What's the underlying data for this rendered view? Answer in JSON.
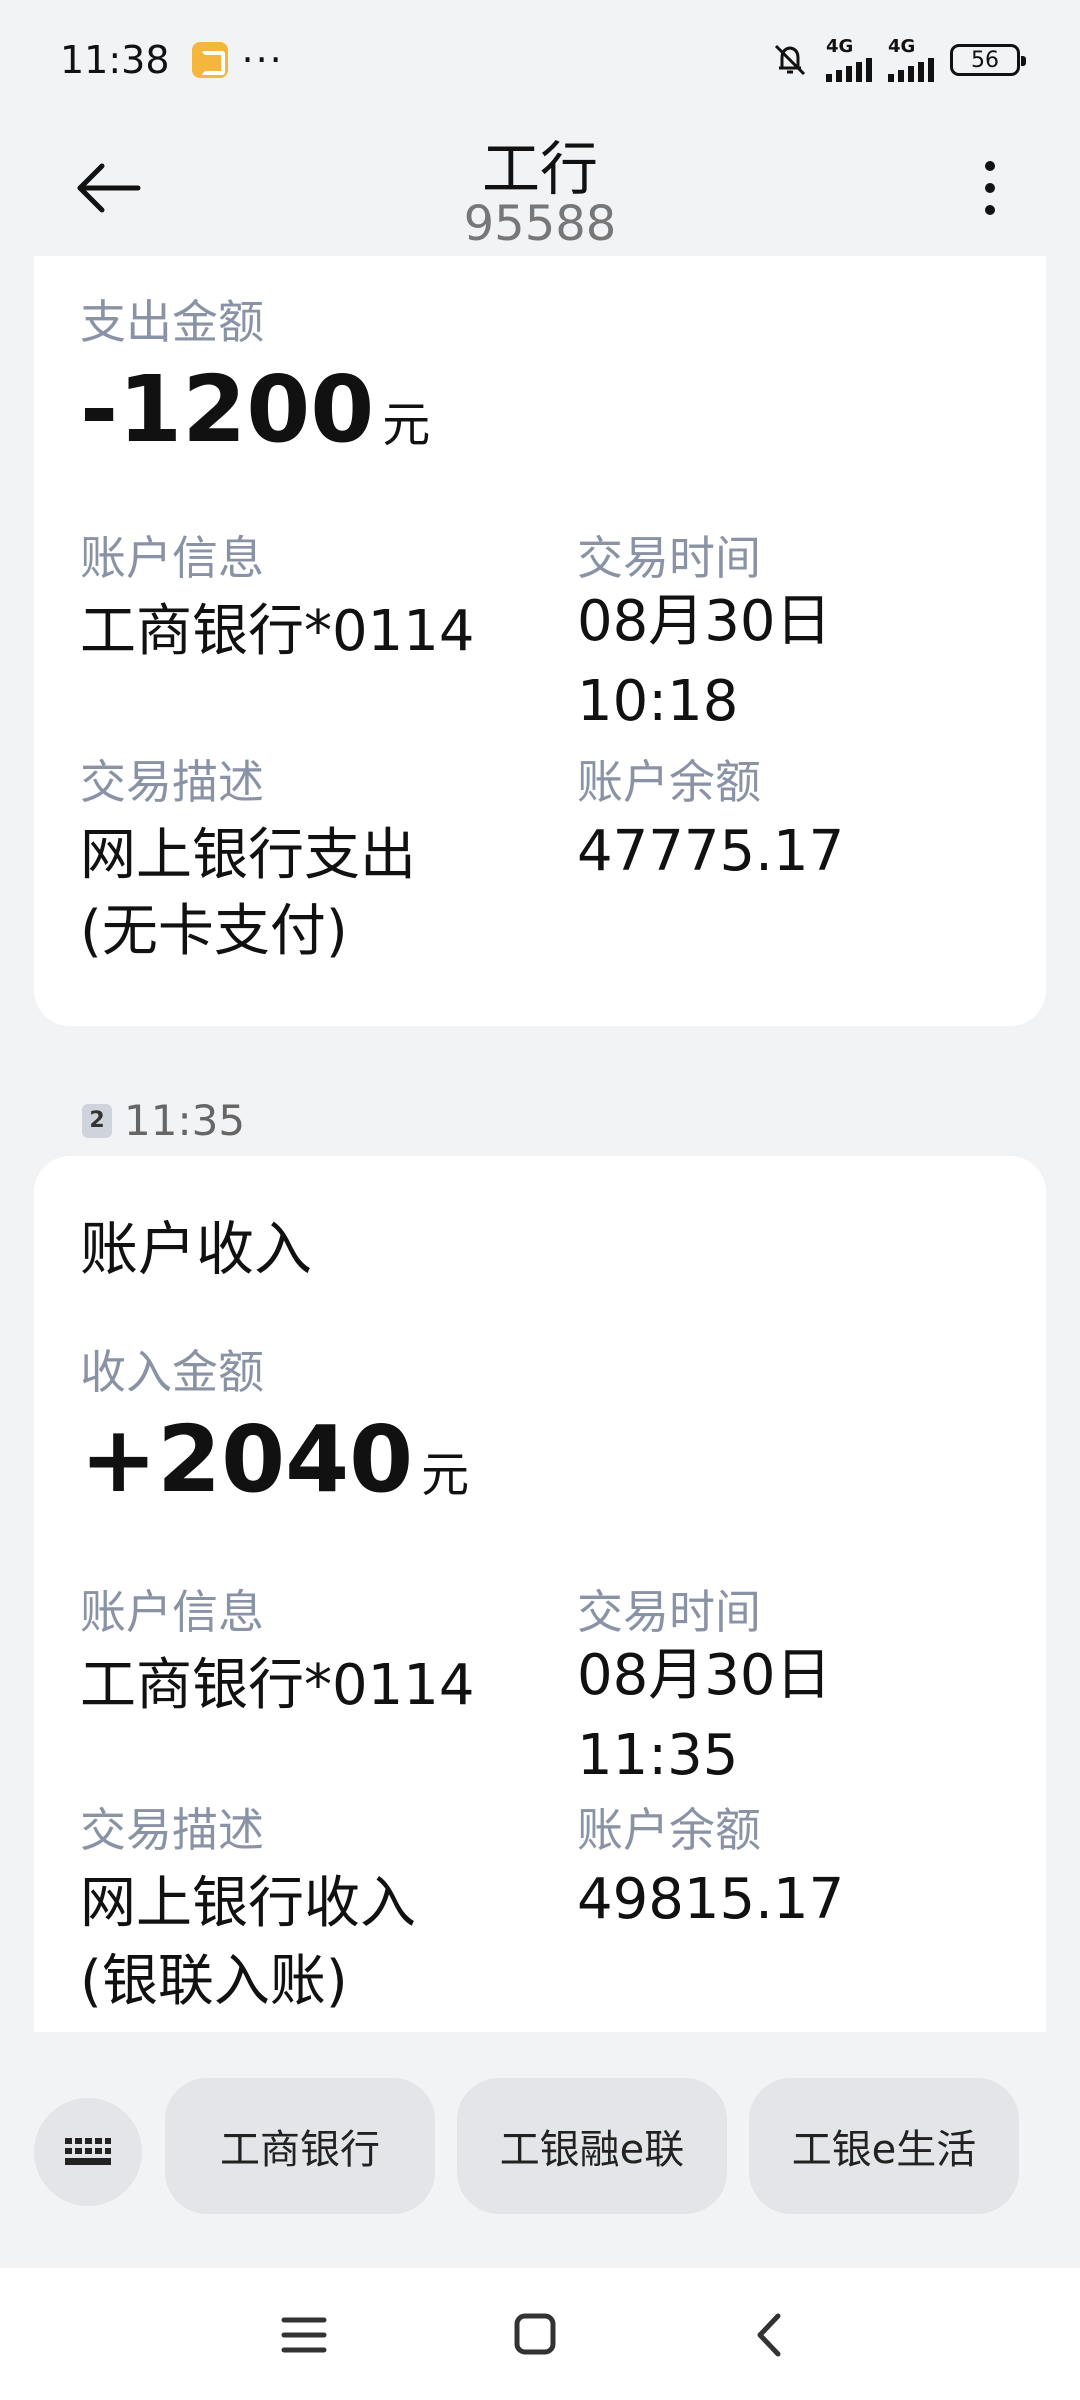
{
  "status_bar": {
    "time": "11:38",
    "dots": "···",
    "signal1_label": "4G",
    "signal2_label": "4G",
    "battery": "56"
  },
  "header": {
    "title": "工行",
    "subtitle": "95588"
  },
  "messages": [
    {
      "amount_label": "支出金额",
      "amount": "-1200",
      "unit": "元",
      "account_label": "账户信息",
      "account": "工商银行*0114",
      "time_label": "交易时间",
      "time_date": "08月30日",
      "time_clock": "10:18",
      "desc_label": "交易描述",
      "desc_line1": "网上银行支出",
      "desc_line2": "(无卡支付)",
      "balance_label": "账户余额",
      "balance": "47775.17"
    },
    {
      "timestamp": "11:35",
      "sim": "2",
      "title": "账户收入",
      "amount_label": "收入金额",
      "amount": "+2040",
      "unit": "元",
      "account_label": "账户信息",
      "account": "工商银行*0114",
      "time_label": "交易时间",
      "time_date": "08月30日",
      "time_clock": "11:35",
      "desc_label": "交易描述",
      "desc_line1": "网上银行收入",
      "desc_line2": "(银联入账)",
      "balance_label": "账户余额",
      "balance": "49815.17"
    }
  ],
  "quick_replies": [
    "工商银行",
    "工银融e联",
    "工银e生活"
  ],
  "icons": {
    "back": "arrow-left-icon",
    "more": "more-vertical-icon",
    "keyboard": "keyboard-icon",
    "nav_menu": "menu-icon",
    "nav_home": "square-icon",
    "nav_back": "chevron-left-icon"
  },
  "colors": {
    "background": "#f2f3f5",
    "card": "#ffffff",
    "label": "#8a93a6",
    "chip": "#e4e5e8"
  }
}
